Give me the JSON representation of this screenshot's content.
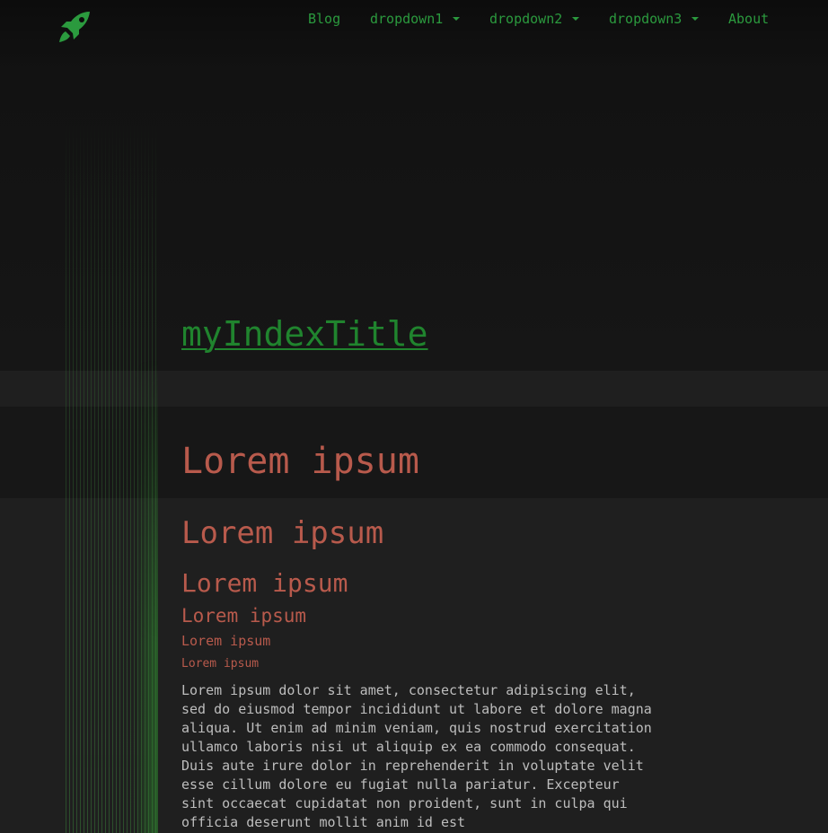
{
  "nav": {
    "logo_icon": "rocket-icon",
    "items": [
      {
        "label": "Blog"
      },
      {
        "label": "dropdown1"
      },
      {
        "label": "dropdown2"
      },
      {
        "label": "dropdown3"
      },
      {
        "label": "About"
      }
    ]
  },
  "page": {
    "title": "myIndexTitle"
  },
  "content": {
    "h1": "Lorem ipsum",
    "h2": "Lorem ipsum",
    "h3": "Lorem ipsum",
    "h4": "Lorem ipsum",
    "h5": "Lorem ipsum",
    "h6": "Lorem ipsum",
    "paragraph": "Lorem ipsum dolor sit amet, consectetur adipiscing elit, sed do eiusmod tempor incididunt ut labore et dolore magna aliqua. Ut enim ad minim veniam, quis nostrud exercitation ullamco laboris nisi ut aliquip ex ea commodo consequat. Duis aute irure dolor in reprehenderit in voluptate velit esse cillum dolore eu fugiat nulla pariatur. Excepteur sint occaecat cupidatat non proident, sunt in culpa qui officia deserunt mollit anim id est"
  },
  "colors": {
    "accent_green": "#2b9a3e",
    "heading_red": "#b85a4c",
    "text_gray": "#bdbdbd"
  }
}
